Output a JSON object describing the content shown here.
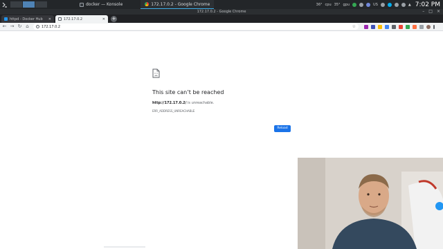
{
  "panel": {
    "tasks": [
      {
        "label": "docker — Konsole"
      },
      {
        "label": "172.17.0.2 - Google Chrome"
      }
    ],
    "tray": {
      "temp1": "36°",
      "label1": "cpu",
      "temp2": "35°",
      "label2": "gpu",
      "locale": "US",
      "clock": "7:02 PM"
    }
  },
  "window": {
    "title": "172.17.0.2 - Google Chrome"
  },
  "tabs": [
    {
      "label": "httpd - Docker Hub",
      "active": false
    },
    {
      "label": "172.17.0.2",
      "active": true
    }
  ],
  "toolbar": {
    "url": "172.17.0.2"
  },
  "error": {
    "title": "This site can’t be reached",
    "host": "http://172.17.0.2/",
    "desc_suffix": " is unreachable.",
    "code": "ERR_ADDRESS_UNREACHABLE",
    "reload_label": "Reload"
  },
  "colors": {
    "panel_bg": "#232629",
    "accent_blue": "#1a73e8",
    "tab_strip": "#202124"
  }
}
